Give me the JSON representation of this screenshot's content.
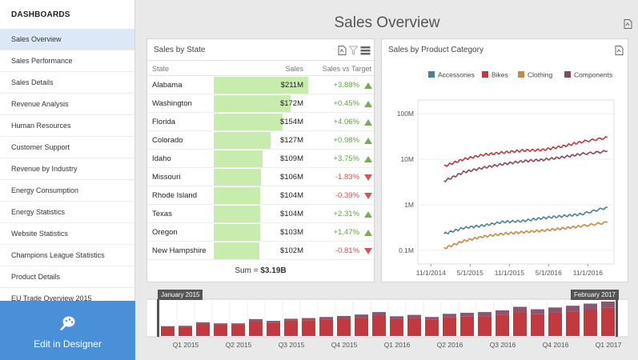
{
  "sidebar": {
    "header": "DASHBOARDS",
    "items": [
      {
        "label": "Sales Overview",
        "active": true
      },
      {
        "label": "Sales Performance"
      },
      {
        "label": "Sales Details"
      },
      {
        "label": "Revenue Analysis"
      },
      {
        "label": "Human Resources"
      },
      {
        "label": "Customer Support"
      },
      {
        "label": "Revenue by Industry"
      },
      {
        "label": "Energy Consumption"
      },
      {
        "label": "Energy Statistics"
      },
      {
        "label": "Website Statistics"
      },
      {
        "label": "Champions League Statistics"
      },
      {
        "label": "Product Details"
      },
      {
        "label": "EU Trade Overview 2015"
      }
    ],
    "edit_designer_label": "Edit in Designer"
  },
  "page": {
    "title": "Sales Overview"
  },
  "state_panel": {
    "title": "Sales by State",
    "columns": [
      "State",
      "Sales",
      "Sales vs Target"
    ],
    "rows": [
      {
        "state": "Alabama",
        "sales": "$211M",
        "value": 211,
        "delta": "+3.88%",
        "trend": "up"
      },
      {
        "state": "Washington",
        "sales": "$172M",
        "value": 172,
        "delta": "+0.45%",
        "trend": "up"
      },
      {
        "state": "Florida",
        "sales": "$154M",
        "value": 154,
        "delta": "+4.06%",
        "trend": "up"
      },
      {
        "state": "Colorado",
        "sales": "$127M",
        "value": 127,
        "delta": "+0.98%",
        "trend": "up"
      },
      {
        "state": "Idaho",
        "sales": "$109M",
        "value": 109,
        "delta": "+3.75%",
        "trend": "up"
      },
      {
        "state": "Missouri",
        "sales": "$106M",
        "value": 106,
        "delta": "-1.83%",
        "trend": "down"
      },
      {
        "state": "Rhode Island",
        "sales": "$104M",
        "value": 104,
        "delta": "-0.39%",
        "trend": "down"
      },
      {
        "state": "Texas",
        "sales": "$104M",
        "value": 104,
        "delta": "+2.31%",
        "trend": "up"
      },
      {
        "state": "Oregon",
        "sales": "$103M",
        "value": 103,
        "delta": "+1.47%",
        "trend": "up"
      },
      {
        "state": "New Hampshire",
        "sales": "$102M",
        "value": 102,
        "delta": "-0.81%",
        "trend": "down"
      }
    ],
    "sum_label": "Sum = ",
    "sum_value": "$3.19B"
  },
  "product_panel": {
    "title": "Sales by Product Category"
  },
  "range": {
    "start_badge": "January 2015",
    "end_badge": "February 2017",
    "labels": [
      "Q1 2015",
      "Q2 2015",
      "Q3 2015",
      "Q4 2015",
      "Q1 2016",
      "Q2 2016",
      "Q3 2016",
      "Q4 2016",
      "Q1 2017"
    ]
  },
  "chart_data": [
    {
      "type": "line",
      "title": "Sales by Product Category",
      "y_scale": "log",
      "ylim": [
        50000,
        200000000
      ],
      "y_ticks": [
        "0.1M",
        "1M",
        "10M",
        "100M"
      ],
      "x_ticks": [
        "11/1/2014",
        "5/1/2015",
        "11/1/2015",
        "5/1/2016",
        "11/1/2016"
      ],
      "legend_position": "top",
      "x": [
        "2015-01",
        "2015-04",
        "2015-07",
        "2015-10",
        "2016-01",
        "2016-04",
        "2016-07",
        "2016-10",
        "2017-02"
      ],
      "series": [
        {
          "name": "Accessories",
          "color": "#4d8196",
          "values": [
            230000,
            310000,
            350000,
            420000,
            440000,
            510000,
            560000,
            620000,
            880000
          ]
        },
        {
          "name": "Bikes",
          "color": "#c0393c",
          "values": [
            7000000,
            10000000,
            12500000,
            14000000,
            15500000,
            16000000,
            19000000,
            24000000,
            30000000
          ]
        },
        {
          "name": "Clothing",
          "color": "#c98a3f",
          "values": [
            110000,
            160000,
            200000,
            230000,
            250000,
            270000,
            300000,
            340000,
            410000
          ]
        },
        {
          "name": "Components",
          "color": "#8a4561",
          "values": [
            3300000,
            5200000,
            6500000,
            7800000,
            9000000,
            9700000,
            11000000,
            13000000,
            15000000
          ]
        }
      ]
    },
    {
      "type": "bar",
      "title": "",
      "description_stacked": true,
      "categories": [
        "2015-01",
        "2015-02",
        "2015-03",
        "2015-04",
        "2015-05",
        "2015-06",
        "2015-07",
        "2015-08",
        "2015-09",
        "2015-10",
        "2015-11",
        "2015-12",
        "2016-01",
        "2016-02",
        "2016-03",
        "2016-04",
        "2016-05",
        "2016-06",
        "2016-07",
        "2016-08",
        "2016-09",
        "2016-10",
        "2016-11",
        "2016-12",
        "2017-01",
        "2017-02"
      ],
      "series": [
        {
          "color": "#c23a3f",
          "values": [
            0.25,
            0.26,
            0.35,
            0.32,
            0.32,
            0.43,
            0.38,
            0.44,
            0.45,
            0.47,
            0.49,
            0.52,
            0.58,
            0.48,
            0.51,
            0.46,
            0.53,
            0.55,
            0.56,
            0.6,
            0.68,
            0.62,
            0.66,
            0.7,
            0.75,
            0.8
          ]
        },
        {
          "color": "#8e5470",
          "values": [
            0.03,
            0.03,
            0.04,
            0.04,
            0.04,
            0.05,
            0.05,
            0.05,
            0.06,
            0.07,
            0.08,
            0.09,
            0.1,
            0.08,
            0.09,
            0.08,
            0.1,
            0.11,
            0.12,
            0.13,
            0.15,
            0.14,
            0.15,
            0.16,
            0.17,
            0.18
          ]
        }
      ]
    }
  ]
}
